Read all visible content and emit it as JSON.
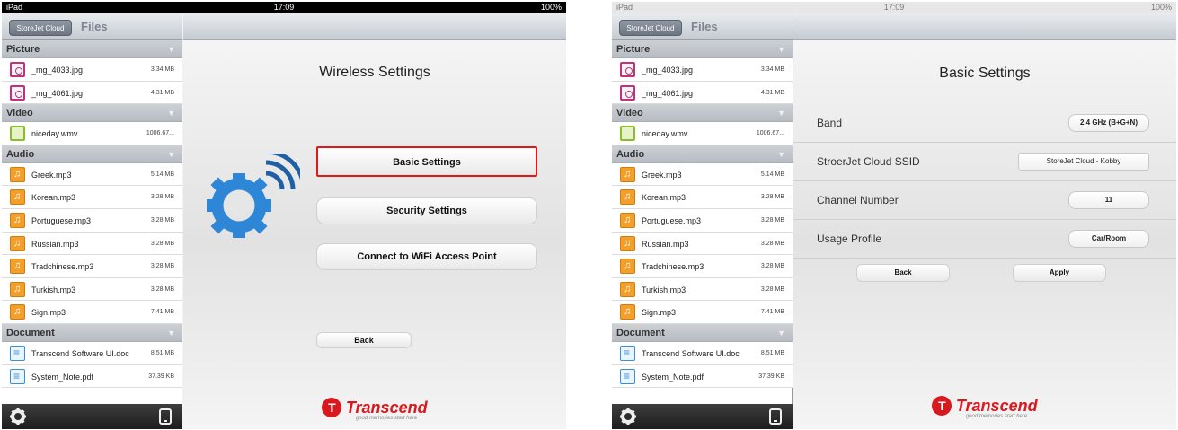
{
  "status": {
    "carrier": "iPad",
    "wifi_icon": "wifi-icon",
    "time": "17:09",
    "battery": "100%",
    "battery_icon": "battery-icon"
  },
  "sidebar": {
    "back_label": "StoreJet Cloud",
    "title": "Files",
    "sections": [
      {
        "name": "Picture",
        "items": [
          {
            "name": "_mg_4033.jpg",
            "size": "3.34 MB",
            "icon": "picture-file-icon"
          },
          {
            "name": "_mg_4061.jpg",
            "size": "4.31 MB",
            "icon": "picture-file-icon"
          }
        ]
      },
      {
        "name": "Video",
        "items": [
          {
            "name": "niceday.wmv",
            "size": "1006.67...",
            "icon": "video-file-icon"
          }
        ]
      },
      {
        "name": "Audio",
        "items": [
          {
            "name": "Greek.mp3",
            "size": "5.14 MB",
            "icon": "audio-file-icon"
          },
          {
            "name": "Korean.mp3",
            "size": "3.28 MB",
            "icon": "audio-file-icon"
          },
          {
            "name": "Portuguese.mp3",
            "size": "3.28 MB",
            "icon": "audio-file-icon"
          },
          {
            "name": "Russian.mp3",
            "size": "3.28 MB",
            "icon": "audio-file-icon"
          },
          {
            "name": "Tradchinese.mp3",
            "size": "3.28 MB",
            "icon": "audio-file-icon"
          },
          {
            "name": "Turkish.mp3",
            "size": "3.28 MB",
            "icon": "audio-file-icon"
          },
          {
            "name": "Sign.mp3",
            "size": "7.41 MB",
            "icon": "audio-file-icon"
          }
        ]
      },
      {
        "name": "Document",
        "items": [
          {
            "name": "Transcend Software UI.doc",
            "size": "8.51 MB",
            "icon": "document-file-icon"
          },
          {
            "name": "System_Note.pdf",
            "size": "37.39 KB",
            "icon": "document-file-icon"
          }
        ]
      }
    ],
    "footer_icons": [
      "settings-gear-icon",
      "device-icon"
    ]
  },
  "wireless": {
    "title": "Wireless Settings",
    "basic_label": "Basic Settings",
    "security_label": "Security Settings",
    "wifi_label": "Connect to WiFi Access Point",
    "back_label": "Back",
    "highlight_color": "#e01818"
  },
  "basic": {
    "title": "Basic Settings",
    "fields": [
      {
        "label": "Band",
        "value": "2.4 GHz (B+G+N)"
      },
      {
        "label": "StroerJet Cloud SSID",
        "value": "StoreJet Cloud - Kobby"
      },
      {
        "label": "Channel Number",
        "value": "11"
      },
      {
        "label": "Usage Profile",
        "value": "Car/Room"
      }
    ],
    "back_label": "Back",
    "apply_label": "Apply"
  },
  "brand": {
    "name": "Transcend",
    "tagline": "good memories start here",
    "color": "#d81920"
  }
}
